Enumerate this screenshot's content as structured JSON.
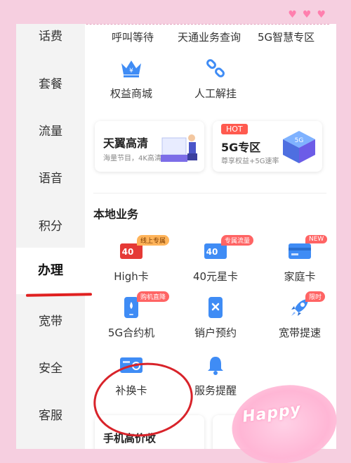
{
  "sidebar": {
    "items": [
      {
        "label": "话费"
      },
      {
        "label": "套餐"
      },
      {
        "label": "流量"
      },
      {
        "label": "语音"
      },
      {
        "label": "积分"
      },
      {
        "label": "办理",
        "active": true
      },
      {
        "label": "宽带"
      },
      {
        "label": "安全"
      },
      {
        "label": "客服"
      }
    ]
  },
  "top_row": {
    "items": [
      {
        "label": "呼叫等待"
      },
      {
        "label": "天通业务查询"
      },
      {
        "label": "5G智慧专区"
      }
    ]
  },
  "services": {
    "items": [
      {
        "label": "权益商城",
        "icon": "crown-icon"
      },
      {
        "label": "人工解挂",
        "icon": "chain-link-icon"
      }
    ]
  },
  "banners": [
    {
      "title": "天翼高清",
      "subtitle": "海量节目，4K高清"
    },
    {
      "tag": "HOT",
      "title": "5G专区",
      "subtitle": "尊享权益+5G速率"
    }
  ],
  "local": {
    "title": "本地业务",
    "items": [
      {
        "label": "High卡",
        "badge": "线上专属",
        "icon_text": "40"
      },
      {
        "label": "40元星卡",
        "badge": "专属流量",
        "icon_text": "40"
      },
      {
        "label": "家庭卡",
        "badge": "NEW"
      },
      {
        "label": "5G合约机",
        "badge": "购机直降"
      },
      {
        "label": "销户预约"
      },
      {
        "label": "宽带提速",
        "badge": "限时"
      },
      {
        "label": "补换卡"
      },
      {
        "label": "服务提醒"
      }
    ]
  },
  "bottom": {
    "card_title": "手机高价收"
  },
  "sticker": {
    "text": "Happy"
  },
  "colors": {
    "accent_red": "#e02020",
    "badge_red": "#ff6464",
    "icon_blue": "#3f8cf5",
    "page_bg": "#f6cfe0"
  }
}
